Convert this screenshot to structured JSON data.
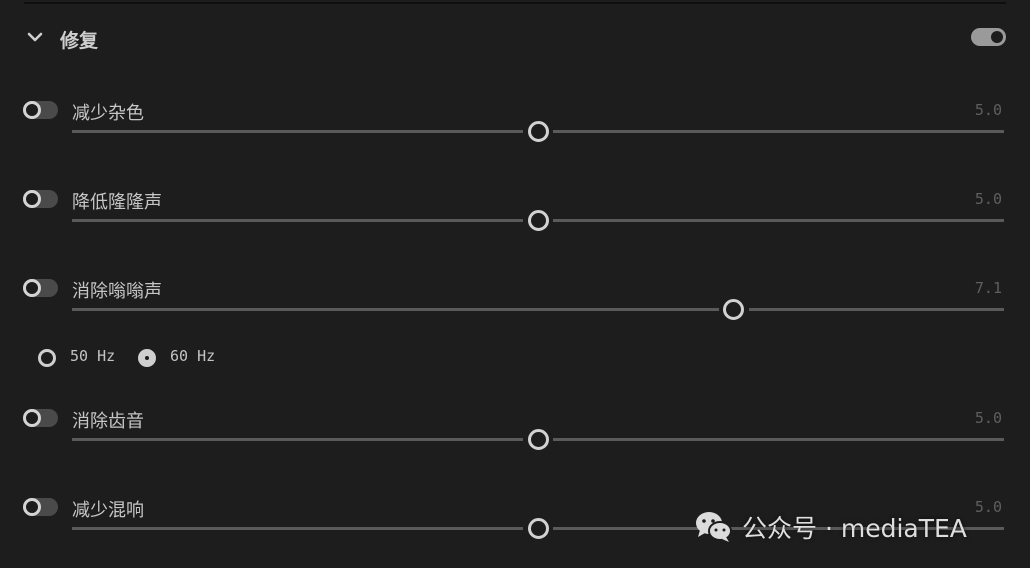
{
  "section": {
    "title": "修复",
    "expanded": true,
    "enabled": true
  },
  "controls": [
    {
      "id": "noise",
      "label": "减少杂色",
      "value": "5.0",
      "enabled": false,
      "fraction": 0.5
    },
    {
      "id": "rumble",
      "label": "降低隆隆声",
      "value": "5.0",
      "enabled": false,
      "fraction": 0.5
    },
    {
      "id": "hum",
      "label": "消除嗡嗡声",
      "value": "7.1",
      "enabled": false,
      "fraction": 0.71
    },
    {
      "id": "sibilance",
      "label": "消除齿音",
      "value": "5.0",
      "enabled": false,
      "fraction": 0.5
    },
    {
      "id": "reverb",
      "label": "减少混响",
      "value": "5.0",
      "enabled": false,
      "fraction": 0.5
    }
  ],
  "hum_frequency": {
    "options": [
      "50 Hz",
      "60 Hz"
    ],
    "selected": "60 Hz"
  },
  "watermark": {
    "text": "公众号 · mediaTEA",
    "icon": "wechat-icon"
  },
  "colors": {
    "background": "#1d1d1d",
    "text": "#c6c6c6",
    "value_text": "#5f5f5f",
    "track": "#5a5a5a",
    "thumb_border": "#d2d2d2",
    "toggle_off": "#4a4a4a",
    "toggle_on": "#9a9a9a"
  }
}
